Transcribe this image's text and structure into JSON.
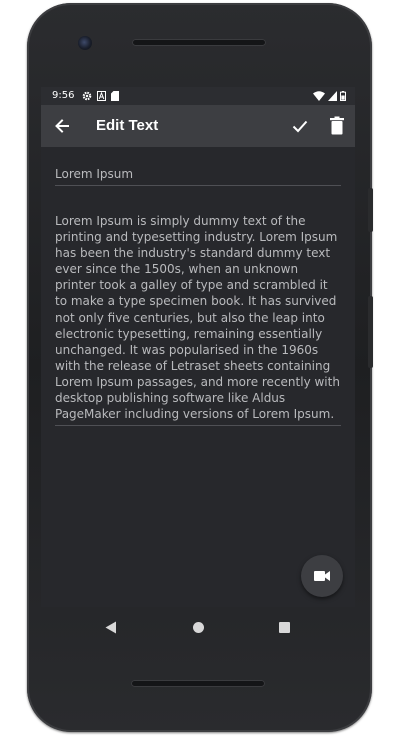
{
  "status_bar": {
    "time": "9:56",
    "left_icons": [
      "gear-icon",
      "a-icon",
      "sim-card-icon"
    ],
    "right_icons": [
      "wifi-icon",
      "signal-icon",
      "battery-icon"
    ]
  },
  "app_bar": {
    "title": "Edit Text",
    "back_icon": "arrow-back-icon",
    "actions": [
      "check-icon",
      "trash-icon"
    ]
  },
  "note": {
    "title": "Lorem Ipsum",
    "body": "Lorem Ipsum is simply dummy text of the printing and typesetting industry. Lorem Ipsum has been the industry's standard dummy text ever since the 1500s, when an unknown printer took a galley of type and scrambled it to make a type specimen book. It has survived not only five centuries, but also the leap into electronic typesetting, remaining essentially unchanged. It was popularised in the 1960s with the release of Letraset sheets containing Lorem Ipsum passages, and more recently with desktop publishing software like Aldus PageMaker including versions of Lorem Ipsum."
  },
  "fab": {
    "icon": "videocam-icon"
  },
  "nav_bar": {
    "icons": [
      "nav-back-icon",
      "nav-home-icon",
      "nav-recents-icon"
    ]
  },
  "colors": {
    "screen_bg": "#27282c",
    "app_bar_bg": "#3d3e42",
    "text": "#b9babd",
    "phone_body": "#1e1f21"
  }
}
